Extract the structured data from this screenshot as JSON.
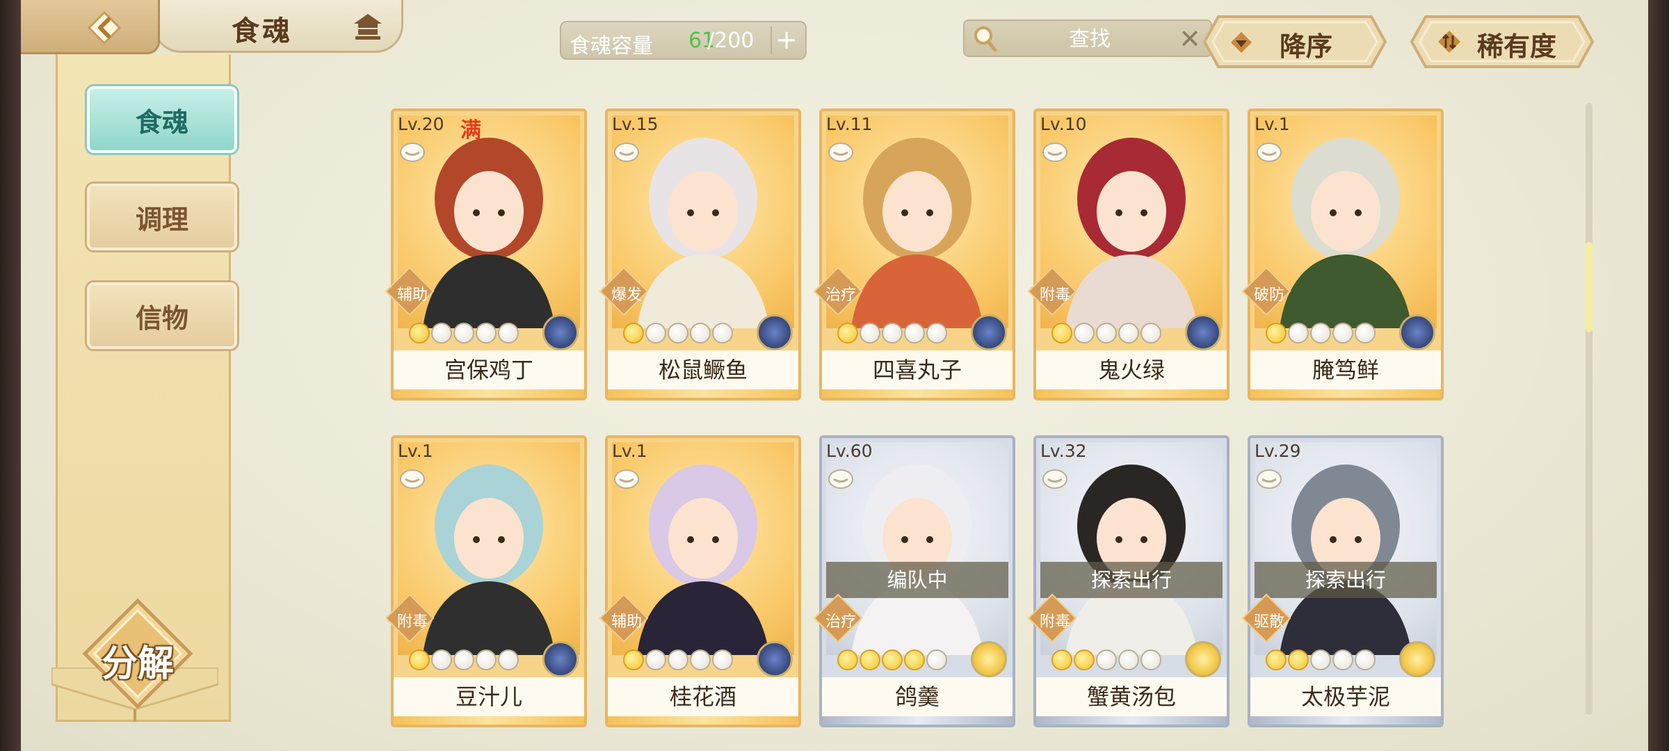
{
  "header": {
    "title": "食魂",
    "capacity_label": "食魂容量",
    "capacity_current": "61",
    "capacity_max": "/200",
    "capacity_plus": "+",
    "search_placeholder": "查找",
    "search_clear": "✕",
    "sort_order_label": "降序",
    "sort_rarity_label": "稀有度"
  },
  "sidebar": {
    "items": [
      {
        "label": "食魂",
        "active": true
      },
      {
        "label": "调理",
        "active": false
      },
      {
        "label": "信物",
        "active": false
      }
    ],
    "decompose_label": "分解"
  },
  "cards": [
    {
      "level": "Lv.20",
      "full": "满",
      "type": "辅助",
      "stars": 1,
      "element": "blue",
      "name": "宫保鸡丁",
      "rarity": "gold",
      "status": ""
    },
    {
      "level": "Lv.15",
      "full": "",
      "type": "爆发",
      "stars": 1,
      "element": "blue",
      "name": "松鼠鳜鱼",
      "rarity": "gold",
      "status": ""
    },
    {
      "level": "Lv.11",
      "full": "",
      "type": "治疗",
      "stars": 1,
      "element": "blue",
      "name": "四喜丸子",
      "rarity": "gold",
      "status": ""
    },
    {
      "level": "Lv.10",
      "full": "",
      "type": "附毒",
      "stars": 1,
      "element": "blue",
      "name": "鬼火绿",
      "rarity": "gold",
      "status": ""
    },
    {
      "level": "Lv.1",
      "full": "",
      "type": "破防",
      "stars": 1,
      "element": "blue",
      "name": "腌笃鲜",
      "rarity": "gold",
      "status": ""
    },
    {
      "level": "Lv.1",
      "full": "",
      "type": "附毒",
      "stars": 1,
      "element": "blue",
      "name": "豆汁儿",
      "rarity": "gold",
      "status": ""
    },
    {
      "level": "Lv.1",
      "full": "",
      "type": "辅助",
      "stars": 1,
      "element": "blue",
      "name": "桂花酒",
      "rarity": "gold",
      "status": ""
    },
    {
      "level": "Lv.60",
      "full": "",
      "type": "治疗",
      "stars": 4,
      "element": "yellow",
      "name": "鸽羹",
      "rarity": "silver",
      "status": "编队中"
    },
    {
      "level": "Lv.32",
      "full": "",
      "type": "附毒",
      "stars": 2,
      "element": "yellow",
      "name": "蟹黄汤包",
      "rarity": "silver",
      "status": "探索出行"
    },
    {
      "level": "Lv.29",
      "full": "",
      "type": "驱散",
      "stars": 2,
      "element": "yellow",
      "name": "太极芋泥",
      "rarity": "silver",
      "status": "探索出行"
    }
  ],
  "colors": {
    "accent_teal": "#8fd6cb",
    "gold_frame": "#e9b560",
    "silver_frame": "#a8b2c4",
    "capacity_green": "#4fc24a"
  }
}
